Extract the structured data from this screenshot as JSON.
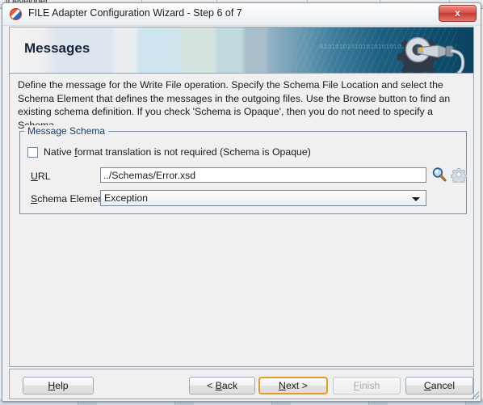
{
  "background": {
    "top_strip_text": "JDeveloper"
  },
  "window": {
    "title": "FILE Adapter Configuration Wizard - Step 6 of 7",
    "app_icon": "oracle-jdeveloper-icon",
    "close_label": "x"
  },
  "banner": {
    "heading": "Messages",
    "decor_bits_1": "010101010101010101010101",
    "decor_bits_2": "10101010",
    "graphic": "gear-wrench-icon"
  },
  "description": "Define the message for the Write File operation.  Specify the Schema File Location and select the Schema Element that defines the messages in the outgoing files. Use the Browse button to find an existing schema definition. If you check 'Schema is Opaque', then you do not need to specify a Schema.",
  "group": {
    "legend": "Message Schema",
    "checkbox": {
      "label_before": "Native ",
      "label_mnemonic": "f",
      "label_after": "ormat translation is not required (Schema is Opaque)",
      "checked": false
    },
    "url": {
      "label_mnemonic": "U",
      "label_after": "RL",
      "value": "../Schemas/Error.xsd",
      "placeholder": "",
      "browse_icon": "magnifier-icon",
      "config_icon": "gear-icon"
    },
    "schema_element": {
      "label_mnemonic": "S",
      "label_after": "chema Element",
      "value": "Exception",
      "options": [
        "Exception"
      ]
    }
  },
  "buttons": {
    "help": {
      "mnemonic": "H",
      "before": "",
      "after": "elp",
      "tail": ""
    },
    "back": {
      "mnemonic": "B",
      "before": "< ",
      "after": "ack",
      "tail": ""
    },
    "next": {
      "mnemonic": "N",
      "before": "",
      "after": "ext",
      "tail": " >"
    },
    "finish": {
      "mnemonic": "F",
      "before": "",
      "after": "inish",
      "tail": ""
    },
    "cancel": {
      "mnemonic": "C",
      "before": "",
      "after": "ancel",
      "tail": ""
    }
  },
  "colors": {
    "accent_focus": "#e59b28",
    "banner_dark": "#0b4361",
    "legend_text": "#17406b",
    "dialog_bg": "#f0f0f0"
  }
}
